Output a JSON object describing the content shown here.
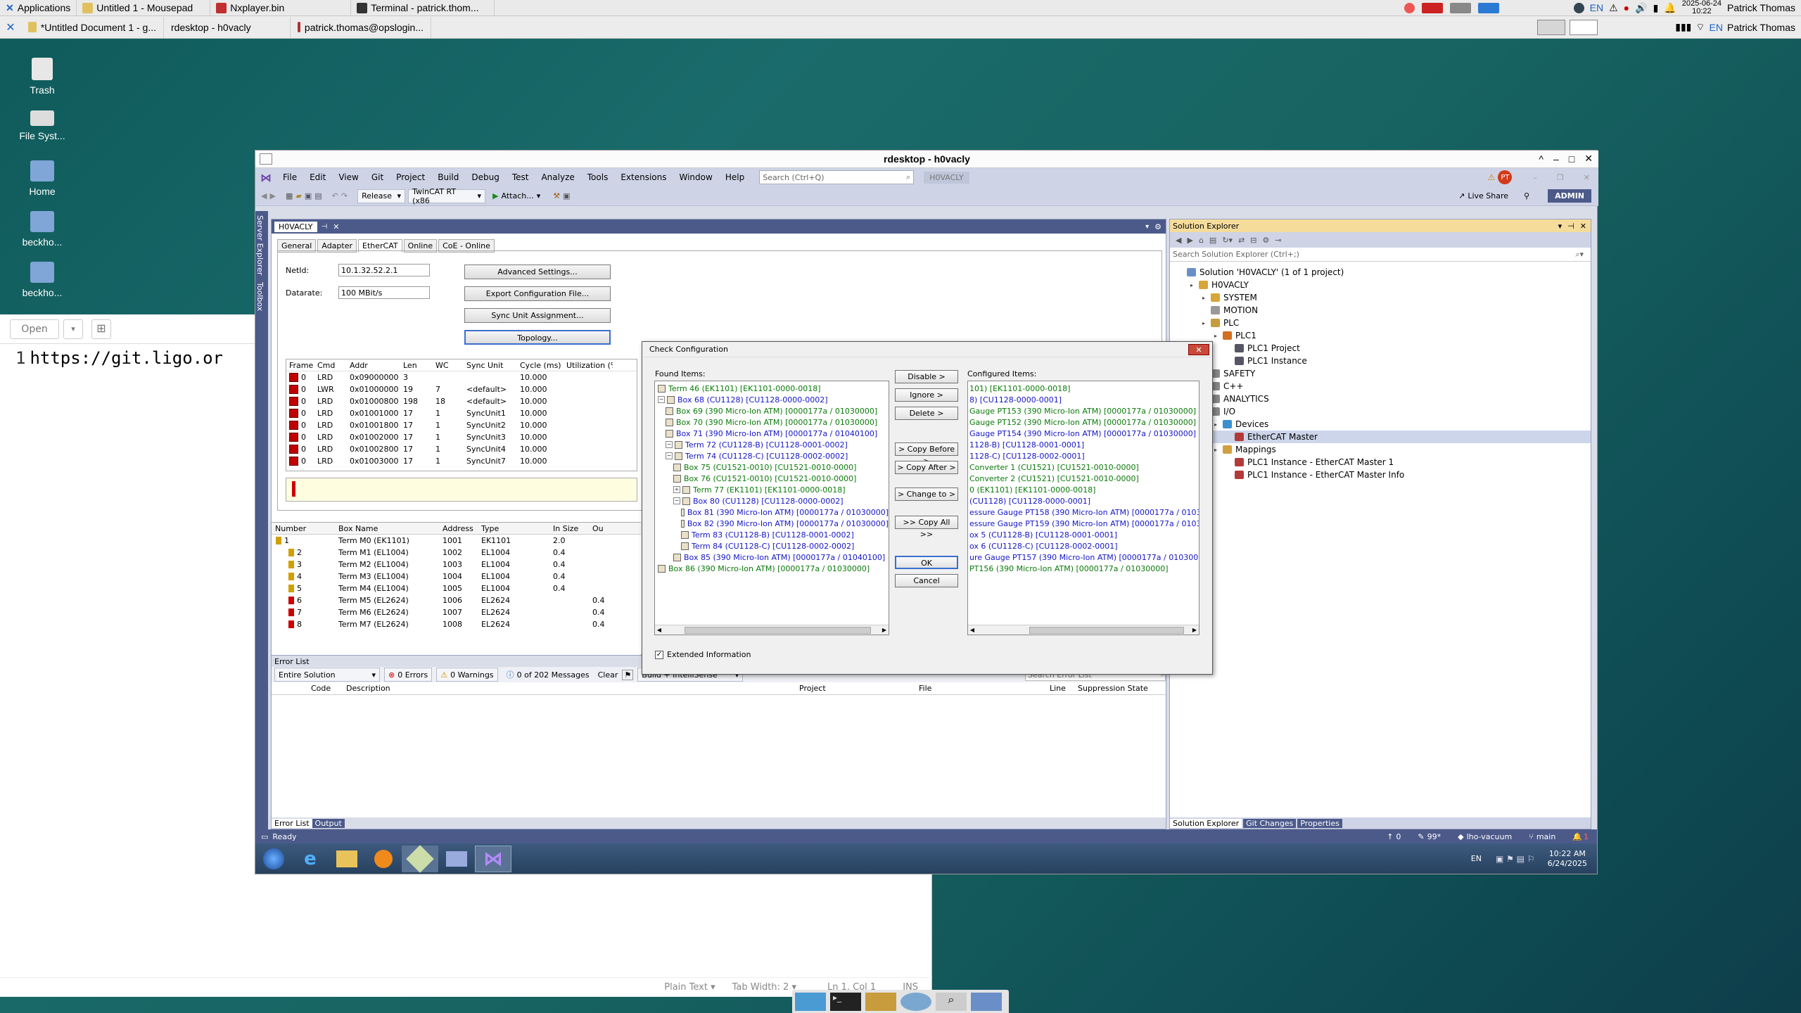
{
  "top_panel": {
    "applications": "Applications",
    "tasks": [
      "Untitled 1 - Mousepad",
      "Nxplayer.bin",
      "Terminal - patrick.thom..."
    ],
    "lang": "EN",
    "date": "2025-06-24",
    "time": "10:22",
    "user": "Patrick Thomas"
  },
  "second_bar": {
    "tabs": [
      "*Untitled Document 1 - g...",
      "rdesktop - h0vacly",
      "patrick.thomas@opslogin..."
    ],
    "lang": "EN",
    "user": "Patrick Thomas"
  },
  "desktop_icons": [
    "Trash",
    "File Syst...",
    "Home",
    "beckho...",
    "beckho..."
  ],
  "mousepad": {
    "open_label": "Open",
    "line_number": "1",
    "line_text": "https://git.ligo.or",
    "status_syntax": "Plain Text ▾",
    "status_tab": "Tab Width: 2 ▾",
    "status_pos": "Ln 1, Col 1",
    "status_mode": "INS"
  },
  "rdesktop_title": "rdesktop - h0vacly",
  "vs": {
    "menu": [
      "File",
      "Edit",
      "View",
      "Git",
      "Project",
      "Build",
      "Debug",
      "Test",
      "Analyze",
      "Tools",
      "Extensions",
      "Window",
      "Help"
    ],
    "search_placeholder": "Search (Ctrl+Q)",
    "solution_name": "H0VACLY",
    "avatar": "PT",
    "config": "Release",
    "platform": "TwinCAT RT (x86",
    "attach": "Attach...",
    "live_share": "Live Share",
    "admin": "ADMIN",
    "side_tabs": [
      "Server Explorer",
      "Toolbox"
    ],
    "doc_tab": "H0VACLY",
    "ethercat": {
      "tabs": [
        "General",
        "Adapter",
        "EtherCAT",
        "Online",
        "CoE - Online"
      ],
      "netid_label": "NetId:",
      "netid_value": "10.1.32.52.2.1",
      "datarate_label": "Datarate:",
      "datarate_value": "100 MBit/s",
      "buttons": [
        "Advanced Settings...",
        "Export Configuration File...",
        "Sync Unit Assignment...",
        "Topology..."
      ],
      "frame_headers": [
        "Frame",
        "Cmd",
        "Addr",
        "Len",
        "WC",
        "Sync Unit",
        "Cycle (ms)",
        "Utilization (%)"
      ],
      "frames": [
        [
          "0",
          "LRD",
          "0x09000000",
          "3",
          "",
          "",
          "10.000"
        ],
        [
          "0",
          "LWR",
          "0x01000000",
          "19",
          "7",
          "<default>",
          "10.000"
        ],
        [
          "0",
          "LRD",
          "0x01000800",
          "198",
          "18",
          "<default>",
          "10.000"
        ],
        [
          "0",
          "LRD",
          "0x01001000",
          "17",
          "1",
          "SyncUnit1",
          "10.000"
        ],
        [
          "0",
          "LRD",
          "0x01001800",
          "17",
          "1",
          "SyncUnit2",
          "10.000"
        ],
        [
          "0",
          "LRD",
          "0x01002000",
          "17",
          "1",
          "SyncUnit3",
          "10.000"
        ],
        [
          "0",
          "LRD",
          "0x01002800",
          "17",
          "1",
          "SyncUnit4",
          "10.000"
        ],
        [
          "0",
          "LRD",
          "0x01003000",
          "17",
          "1",
          "SyncUnit7",
          "10.000"
        ]
      ],
      "device_headers": [
        "Number",
        "Box Name",
        "Address",
        "Type",
        "In Size",
        "Ou"
      ],
      "devices": [
        [
          "1",
          "Term M0 (EK1101)",
          "1001",
          "EK1101",
          "2.0",
          ""
        ],
        [
          "2",
          "Term M1 (EL1004)",
          "1002",
          "EL1004",
          "0.4",
          ""
        ],
        [
          "3",
          "Term M2 (EL1004)",
          "1003",
          "EL1004",
          "0.4",
          ""
        ],
        [
          "4",
          "Term M3 (EL1004)",
          "1004",
          "EL1004",
          "0.4",
          ""
        ],
        [
          "5",
          "Term M4 (EL1004)",
          "1005",
          "EL1004",
          "0.4",
          ""
        ],
        [
          "6",
          "Term M5 (EL2624)",
          "1006",
          "EL2624",
          "",
          "0.4"
        ],
        [
          "7",
          "Term M6 (EL2624)",
          "1007",
          "EL2624",
          "",
          "0.4"
        ],
        [
          "8",
          "Term M7 (EL2624)",
          "1008",
          "EL2624",
          "",
          "0.4"
        ]
      ]
    },
    "error_list": {
      "title": "Error List",
      "scope": "Entire Solution",
      "errors": "0 Errors",
      "warnings": "0 Warnings",
      "messages": "0 of 202 Messages",
      "clear": "Clear",
      "build": "Build + IntelliSense",
      "search": "Search Error List",
      "headers": [
        "Code",
        "Description",
        "Project",
        "File",
        "Line",
        "Suppression State"
      ],
      "bottom_tabs": [
        "Error List",
        "Output"
      ]
    },
    "solution_explorer": {
      "title": "Solution Explorer",
      "search": "Search Solution Explorer (Ctrl+;)",
      "items": [
        {
          "label": "Solution 'H0VACLY' (1 of 1 project)",
          "indent": 0
        },
        {
          "label": "H0VACLY",
          "indent": 1
        },
        {
          "label": "SYSTEM",
          "indent": 2
        },
        {
          "label": "MOTION",
          "indent": 2
        },
        {
          "label": "PLC",
          "indent": 2
        },
        {
          "label": "PLC1",
          "indent": 3
        },
        {
          "label": "PLC1 Project",
          "indent": 4
        },
        {
          "label": "PLC1 Instance",
          "indent": 4
        },
        {
          "label": "SAFETY",
          "indent": 2
        },
        {
          "label": "C++",
          "indent": 2
        },
        {
          "label": "ANALYTICS",
          "indent": 2
        },
        {
          "label": "I/O",
          "indent": 2
        },
        {
          "label": "Devices",
          "indent": 3
        },
        {
          "label": "EtherCAT Master",
          "indent": 4
        },
        {
          "label": "Mappings",
          "indent": 3
        },
        {
          "label": "PLC1 Instance - EtherCAT Master 1",
          "indent": 4
        },
        {
          "label": "PLC1 Instance - EtherCAT Master Info",
          "indent": 4
        }
      ],
      "bottom_tabs": [
        "Solution Explorer",
        "Git Changes",
        "Properties"
      ]
    },
    "status": {
      "ready": "Ready",
      "up": "0",
      "pencil": "99*",
      "repo": "lho-vacuum",
      "branch": "main",
      "bell": "1"
    },
    "win_taskbar": {
      "lang": "EN",
      "time": "10:22 AM",
      "date": "6/24/2025"
    }
  },
  "dialog": {
    "title": "Check Configuration",
    "found_label": "Found Items:",
    "configured_label": "Configured Items:",
    "found": [
      {
        "t": "Term 46 (EK1101)   [EK1101-0000-0018]",
        "c": "g",
        "i": 0
      },
      {
        "t": "Box 68 (CU1128)   [CU1128-0000-0002]",
        "c": "b",
        "i": 0
      },
      {
        "t": "Box 69 (390 Micro-Ion ATM)   [0000177a / 01030000]",
        "c": "g",
        "i": 1
      },
      {
        "t": "Box 70 (390 Micro-Ion ATM)   [0000177a / 01030000]",
        "c": "g",
        "i": 1
      },
      {
        "t": "Box 71 (390 Micro-Ion ATM)   [0000177a / 01040100]",
        "c": "b",
        "i": 1
      },
      {
        "t": "Term 72 (CU1128-B)   [CU1128-0001-0002]",
        "c": "b",
        "i": 1
      },
      {
        "t": "Term 74 (CU1128-C)   [CU1128-0002-0002]",
        "c": "b",
        "i": 1
      },
      {
        "t": "Box 75 (CU1521-0010)   [CU1521-0010-0000]",
        "c": "g",
        "i": 2
      },
      {
        "t": "Box 76 (CU1521-0010)   [CU1521-0010-0000]",
        "c": "g",
        "i": 2
      },
      {
        "t": "Term 77 (EK1101)   [EK1101-0000-0018]",
        "c": "g",
        "i": 2
      },
      {
        "t": "Box 80 (CU1128)   [CU1128-0000-0002]",
        "c": "b",
        "i": 2
      },
      {
        "t": "Box 81 (390 Micro-Ion ATM)   [0000177a / 01030000]",
        "c": "b",
        "i": 3
      },
      {
        "t": "Box 82 (390 Micro-Ion ATM)   [0000177a / 01030000]",
        "c": "b",
        "i": 3
      },
      {
        "t": "Term 83 (CU1128-B)   [CU1128-0001-0002]",
        "c": "b",
        "i": 3
      },
      {
        "t": "Term 84 (CU1128-C)   [CU1128-0002-0002]",
        "c": "b",
        "i": 3
      },
      {
        "t": "Box 85 (390 Micro-Ion ATM)   [0000177a / 01040100]",
        "c": "b",
        "i": 2
      },
      {
        "t": "Box 86 (390 Micro-Ion ATM)   [0000177a / 01030000]",
        "c": "g",
        "i": 0
      }
    ],
    "configured": [
      {
        "t": "101)   [EK1101-0000-0018]",
        "c": "g"
      },
      {
        "t": "8)   [CU1128-0000-0001]",
        "c": "b"
      },
      {
        "t": "Gauge PT153 (390 Micro-Ion ATM)   [0000177a / 01030000]",
        "c": "g"
      },
      {
        "t": "Gauge PT152 (390 Micro-Ion ATM)   [0000177a / 01030000]",
        "c": "g"
      },
      {
        "t": "Gauge PT154 (390 Micro-Ion ATM)   [0000177a / 01030000]",
        "c": "b"
      },
      {
        "t": "1128-B)   [CU1128-0001-0001]",
        "c": "b"
      },
      {
        "t": "1128-C)   [CU1128-0002-0001]",
        "c": "b"
      },
      {
        "t": "Converter 1 (CU1521)   [CU1521-0010-0000]",
        "c": "g"
      },
      {
        "t": "Converter 2 (CU1521)   [CU1521-0010-0000]",
        "c": "g"
      },
      {
        "t": "0 (EK1101)   [EK1101-0000-0018]",
        "c": "g"
      },
      {
        "t": "(CU1128)   [CU1128-0000-0001]",
        "c": "b"
      },
      {
        "t": "essure Gauge PT158 (390 Micro-Ion ATM)   [0000177a / 01030000]",
        "c": "b"
      },
      {
        "t": "essure Gauge PT159 (390 Micro-Ion ATM)   [0000177a / 01030000]",
        "c": "b"
      },
      {
        "t": "ox 5 (CU1128-B)   [CU1128-0001-0001]",
        "c": "b"
      },
      {
        "t": "ox 6 (CU1128-C)   [CU1128-0002-0001]",
        "c": "b"
      },
      {
        "t": "ure Gauge PT157 (390 Micro-Ion ATM)   [0000177a / 01030000]",
        "c": "b"
      },
      {
        "t": "PT156 (390 Micro-Ion ATM)   [0000177a / 01030000]",
        "c": "g"
      }
    ],
    "buttons": {
      "disable": "Disable >",
      "ignore": "Ignore >",
      "delete": "Delete >",
      "copy_before": "> Copy Before >",
      "copy_after": "> Copy After >",
      "change_to": "> Change to >",
      "copy_all": ">> Copy All >>",
      "ok": "OK",
      "cancel": "Cancel"
    },
    "extended_info": "Extended Information"
  },
  "colors": {
    "desktop": "#176361",
    "vs_chrome": "#ced4e6",
    "vs_accent": "#4c5a8a",
    "found_green": "#0a7a0a",
    "found_blue": "#1515c8"
  }
}
